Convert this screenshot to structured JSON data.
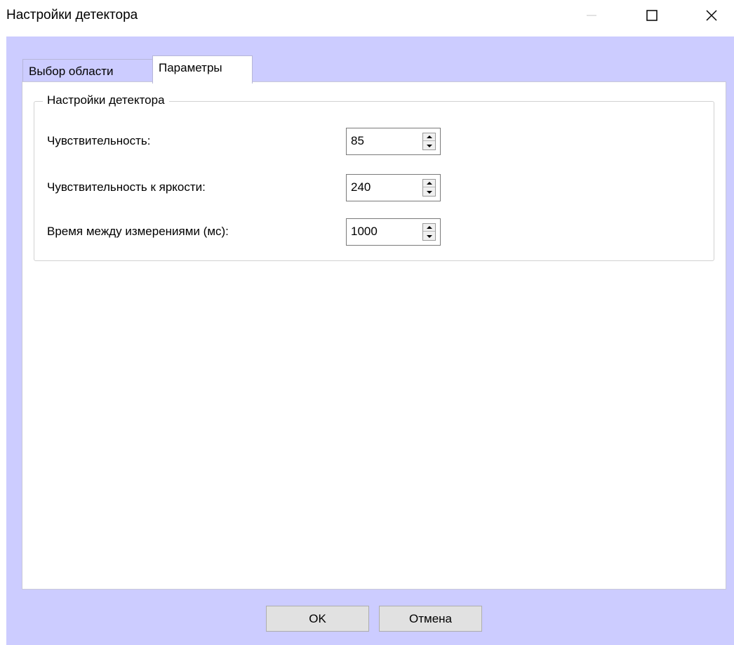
{
  "window": {
    "title": "Настройки детектора"
  },
  "tabs": [
    {
      "label": "Выбор области",
      "active": false
    },
    {
      "label": "Параметры",
      "active": true
    }
  ],
  "group": {
    "legend": "Настройки детектора",
    "fields": [
      {
        "label": "Чувствительность:",
        "value": "85"
      },
      {
        "label": "Чувствительность к яркости:",
        "value": "240"
      },
      {
        "label": "Время между измерениями (мс):",
        "value": "1000"
      }
    ]
  },
  "buttons": {
    "ok": "OK",
    "cancel": "Отмена"
  },
  "colors": {
    "client_background": "#ccccff",
    "panel_background": "#ffffff"
  },
  "icons": {
    "minimize": "minimize-icon",
    "maximize": "maximize-icon",
    "close": "close-icon",
    "spin_up": "arrow-up-icon",
    "spin_down": "arrow-down-icon"
  }
}
